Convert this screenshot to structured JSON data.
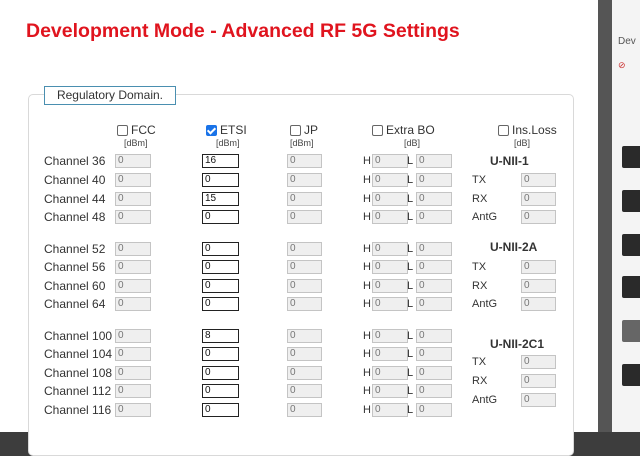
{
  "title": "Development Mode - Advanced RF 5G Settings",
  "legend": "Regulatory Domain.",
  "columns": {
    "fcc": {
      "label": "FCC",
      "unit": "[dBm]",
      "checked": false
    },
    "etsi": {
      "label": "ETSI",
      "unit": "[dBm]",
      "checked": true
    },
    "jp": {
      "label": "JP",
      "unit": "[dBm]",
      "checked": false
    },
    "extra_bo": {
      "label": "Extra BO",
      "unit": "[dB]",
      "checked": false
    },
    "ins_loss": {
      "label": "Ins.Loss",
      "unit": "[dB]",
      "checked": false
    }
  },
  "hl": {
    "h": "H",
    "l": "L"
  },
  "channels": [
    {
      "label": "Channel 36",
      "fcc": "0",
      "etsi": "16",
      "jp": "0",
      "h": "0",
      "l": "0"
    },
    {
      "label": "Channel 40",
      "fcc": "0",
      "etsi": "0",
      "jp": "0",
      "h": "0",
      "l": "0"
    },
    {
      "label": "Channel 44",
      "fcc": "0",
      "etsi": "15",
      "jp": "0",
      "h": "0",
      "l": "0"
    },
    {
      "label": "Channel 48",
      "fcc": "0",
      "etsi": "0",
      "jp": "0",
      "h": "0",
      "l": "0"
    },
    {
      "label": "Channel 52",
      "fcc": "0",
      "etsi": "0",
      "jp": "0",
      "h": "0",
      "l": "0"
    },
    {
      "label": "Channel 56",
      "fcc": "0",
      "etsi": "0",
      "jp": "0",
      "h": "0",
      "l": "0"
    },
    {
      "label": "Channel 60",
      "fcc": "0",
      "etsi": "0",
      "jp": "0",
      "h": "0",
      "l": "0"
    },
    {
      "label": "Channel 64",
      "fcc": "0",
      "etsi": "0",
      "jp": "0",
      "h": "0",
      "l": "0"
    },
    {
      "label": "Channel 100",
      "fcc": "0",
      "etsi": "8",
      "jp": "0",
      "h": "0",
      "l": "0"
    },
    {
      "label": "Channel 104",
      "fcc": "0",
      "etsi": "0",
      "jp": "0",
      "h": "0",
      "l": "0"
    },
    {
      "label": "Channel 108",
      "fcc": "0",
      "etsi": "0",
      "jp": "0",
      "h": "0",
      "l": "0"
    },
    {
      "label": "Channel 112",
      "fcc": "0",
      "etsi": "0",
      "jp": "0",
      "h": "0",
      "l": "0"
    },
    {
      "label": "Channel 116",
      "fcc": "0",
      "etsi": "0",
      "jp": "0",
      "h": "0",
      "l": "0"
    }
  ],
  "groups": [
    {
      "title": "U-NII-1",
      "tx": "0",
      "rx": "0",
      "antg": "0"
    },
    {
      "title": "U-NII-2A",
      "tx": "0",
      "rx": "0",
      "antg": "0"
    },
    {
      "title": "U-NII-2C1",
      "tx": "0",
      "rx": "0",
      "antg": "0"
    }
  ],
  "side_labels": {
    "tx": "TX",
    "rx": "RX",
    "antg": "AntG"
  },
  "background_panel": {
    "text": "Dev"
  }
}
